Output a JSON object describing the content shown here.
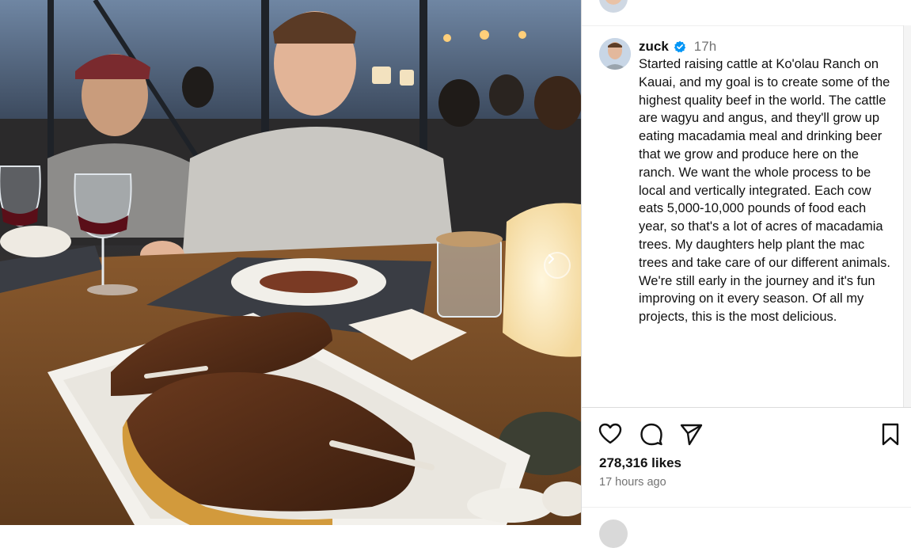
{
  "post": {
    "username": "zuck",
    "time": "17h",
    "caption": "Started raising cattle at Ko'olau Ranch on Kauai, and my goal is to create some of the highest quality beef in the world. The cattle are wagyu and angus, and they'll grow up eating macadamia meal and drinking beer that we grow and produce here on the ranch. We want the whole process to be local and vertically integrated. Each cow eats 5,000-10,000 pounds of food each year, so that's a lot of acres of macadamia trees. My daughters help plant the mac trees and take care of our different animals. We're still early in the journey and it's fun improving on it every season. Of all my projects, this is the most delicious.",
    "likes": "278,316 likes",
    "posted_ago": "17 hours ago"
  },
  "icons": {
    "like": "heart-icon",
    "comment": "comment-icon",
    "share": "send-icon",
    "save": "bookmark-icon",
    "next": "chevron-right-icon",
    "verified": "verified-badge-icon"
  },
  "colors": {
    "verified_blue": "#0095f6",
    "text_primary": "#111111",
    "text_secondary": "#737373",
    "divider": "#dbdbdb"
  }
}
